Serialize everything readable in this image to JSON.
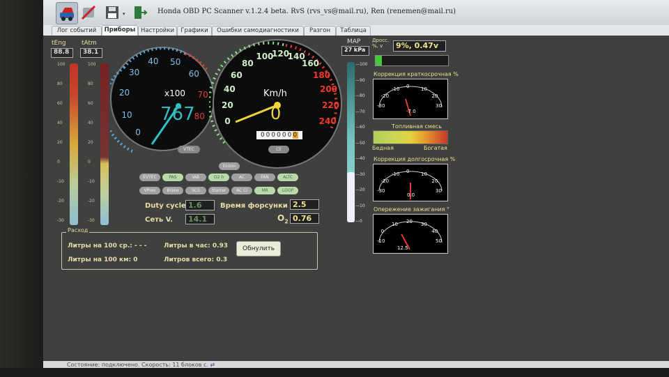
{
  "app": {
    "title": "Honda OBD PC Scanner v.1.2.4 beta. RvS (rvs_vs@mail.ru), Ren (renemen@mail.ru)"
  },
  "tabs": [
    "Лог событий",
    "Приборы",
    "Настройки",
    "Графики",
    "Ошибки самодиагностики",
    "Разгон",
    "Таблица"
  ],
  "temps": {
    "eng_label": "tEng",
    "eng_value": "88.8",
    "atm_label": "tAtm",
    "atm_value": "38.1",
    "scale": [
      "100",
      "80",
      "60",
      "40",
      "20",
      "0",
      "-10",
      "-20",
      "-30"
    ]
  },
  "tacho": {
    "ticks": [
      "0",
      "10",
      "20",
      "30",
      "40",
      "50",
      "60",
      "70",
      "80"
    ],
    "unit": "x100",
    "value": "767",
    "badge": "VTEC"
  },
  "speedo": {
    "ticks": [
      "0",
      "20",
      "40",
      "60",
      "80",
      "100",
      "120",
      "140",
      "160",
      "180",
      "200",
      "220",
      "240"
    ],
    "unit": "Km/h",
    "value": "0",
    "odometer": "000000",
    "odometer_last": "0",
    "badge": "CE"
  },
  "indicators": {
    "row0": [
      "Econo"
    ],
    "row1": [
      "EVTEC",
      "PAS",
      "IAB",
      "O2 h",
      "AC",
      "FAN",
      "ALTC"
    ],
    "row2": [
      "VPres",
      "Brake",
      "SCS",
      "Starter",
      "AC Cl",
      "MR",
      "LOOP"
    ],
    "active": [
      "PAS",
      "O2 h",
      "ALTC",
      "MR",
      "LOOP"
    ]
  },
  "readouts": {
    "duty_label": "Duty cycle",
    "duty_value": "1.6",
    "inj_label": "Время форсунки",
    "inj_value": "2.5",
    "volt_label": "Сеть V.",
    "volt_value": "14.1",
    "o2_label": "O",
    "o2_sub": "2",
    "o2_value": "0.76"
  },
  "consumption": {
    "title": "Расход",
    "per100avg": "Литры на 100 ср.: - - -",
    "per100": "Литры на 100 км: 0",
    "perhour": "Литры в час: 0.93",
    "total": "Литров всего: 0.3",
    "reset_button": "Обнулить"
  },
  "map": {
    "label": "MAP",
    "value": "27 kPa",
    "scale": [
      "100",
      "90",
      "80",
      "70",
      "60",
      "50",
      "40",
      "30",
      "20",
      "10",
      "0"
    ]
  },
  "throttle": {
    "label": "Дросс. %, v",
    "value": "9%, 0.47v"
  },
  "stft": {
    "title": "Коррекция краткосрочная %",
    "ticks": [
      "-30",
      "-20",
      "-10",
      "0",
      "10",
      "20",
      "30"
    ],
    "value": "-7.0"
  },
  "mixture": {
    "title": "Топливная смесь",
    "lean": "Бедная",
    "rich": "Богатая"
  },
  "ltft": {
    "title": "Коррекция долгосрочная %",
    "ticks": [
      "-30",
      "-20",
      "-10",
      "0",
      "10",
      "20",
      "30"
    ],
    "value": "0.0"
  },
  "ignition": {
    "title": "Опережение зажигания °",
    "ticks": [
      "-10",
      "0",
      "10",
      "20",
      "30",
      "40",
      "50"
    ],
    "value": "12.5"
  },
  "status": {
    "text": "Состояние: подключено. Скорость: 11 блоков с."
  }
}
